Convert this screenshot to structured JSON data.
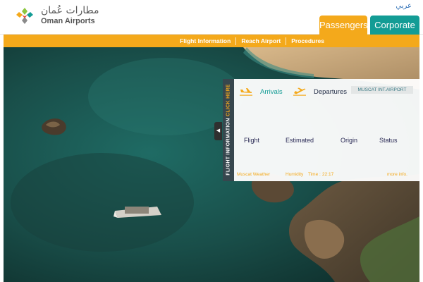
{
  "header": {
    "logo_arabic": "مطارات عُمان",
    "logo_english": "Oman Airports",
    "language_link": "عربي"
  },
  "tabs": {
    "passengers": "Passengers",
    "corporate": "Corporate"
  },
  "nav": {
    "items": [
      {
        "label": "Flight Information"
      },
      {
        "label": "Reach Airport"
      },
      {
        "label": "Procedures"
      }
    ]
  },
  "flight_panel": {
    "side_tab_label": "FLIGHT INFORMATION",
    "side_tab_click": "CLICK HERE",
    "arrivals": "Arrivals",
    "departures": "Departures",
    "airport": "MUSCAT INT.AIRPORT",
    "columns": [
      "Flight",
      "Estimated",
      "Origin",
      "Status"
    ],
    "weather": "Muscat Weather",
    "humidity": "Humidity",
    "time_label": "Time :",
    "time_value": "22:17",
    "more_info": "more info."
  },
  "colors": {
    "brand_orange": "#f4a91b",
    "brand_teal": "#139c95",
    "panel_tab": "#37474e",
    "column_text": "#2a2a55"
  },
  "icons": [
    "oman-airports-logo-icon",
    "arrivals-plane-icon",
    "departures-plane-icon",
    "collapse-arrow-icon"
  ]
}
